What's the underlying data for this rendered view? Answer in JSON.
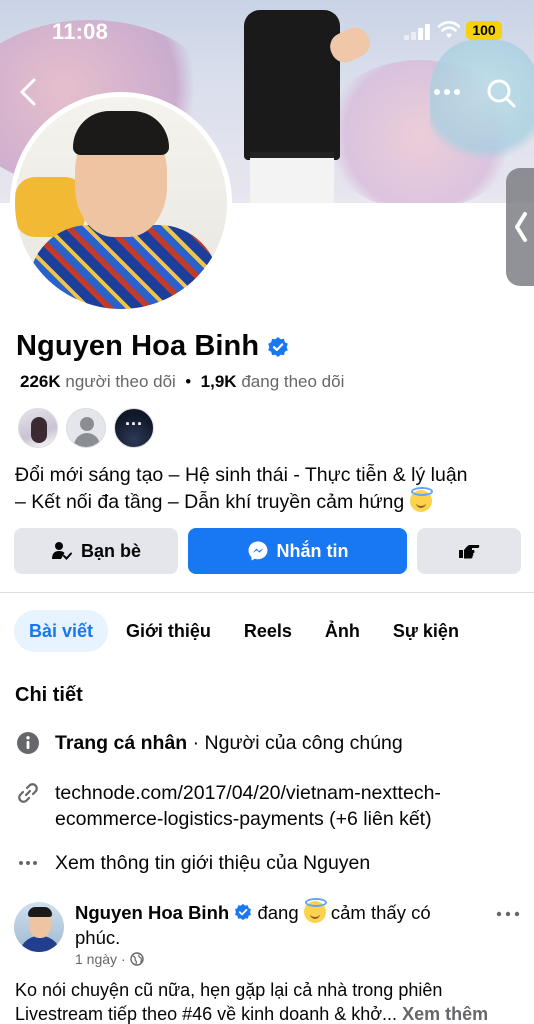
{
  "status_bar": {
    "time": "11:08",
    "battery": "100"
  },
  "cover": {
    "nav": {
      "back_icon": "chevron-left-icon",
      "more_icon": "more-horizontal-icon",
      "search_icon": "search-icon"
    }
  },
  "profile": {
    "name": "Nguyen Hoa Binh",
    "followers_count": "226K",
    "followers_label": "người theo dõi",
    "separator": "•",
    "following_count": "1,9K",
    "following_label": "đang theo dõi",
    "mutual_more": "···",
    "bio_line1": "Đổi mới sáng tạo – Hệ sinh thái - Thực tiễn & lý luận",
    "bio_line2": "– Kết nối đa tầng – Dẫn khí truyền cảm hứng"
  },
  "actions": {
    "friends_label": "Bạn bè",
    "message_label": "Nhắn tin"
  },
  "tabs": [
    {
      "label": "Bài viết",
      "active": true
    },
    {
      "label": "Giới thiệu"
    },
    {
      "label": "Reels"
    },
    {
      "label": "Ảnh"
    },
    {
      "label": "Sự kiện"
    }
  ],
  "details": {
    "title": "Chi tiết",
    "page_type_bold": "Trang cá nhân",
    "page_type_rest": " · Người của công chúng",
    "link_line1": "technode.com/2017/04/20/vietnam-nexttech-",
    "link_line2": "ecommerce-logistics-payments (+6 liên kết)",
    "see_about": "Xem thông tin giới thiệu của Nguyen"
  },
  "post": {
    "author": "Nguyen Hoa Binh",
    "feeling_prefix": "đang",
    "feeling_rest": "cảm thấy có",
    "feeling_line2": "phúc.",
    "time": "1 ngày",
    "dot": "·",
    "text_line1": "Ko nói chuyện cũ nữa, hẹn gặp lại cả nhà trong phiên",
    "text_line2": "Livestream tiếp theo #46 về kinh doanh & khở...",
    "see_more": "Xem thêm"
  },
  "colors": {
    "brand_blue": "#1877f2",
    "secondary_text": "#65676b",
    "button_gray": "#e4e6eb"
  }
}
